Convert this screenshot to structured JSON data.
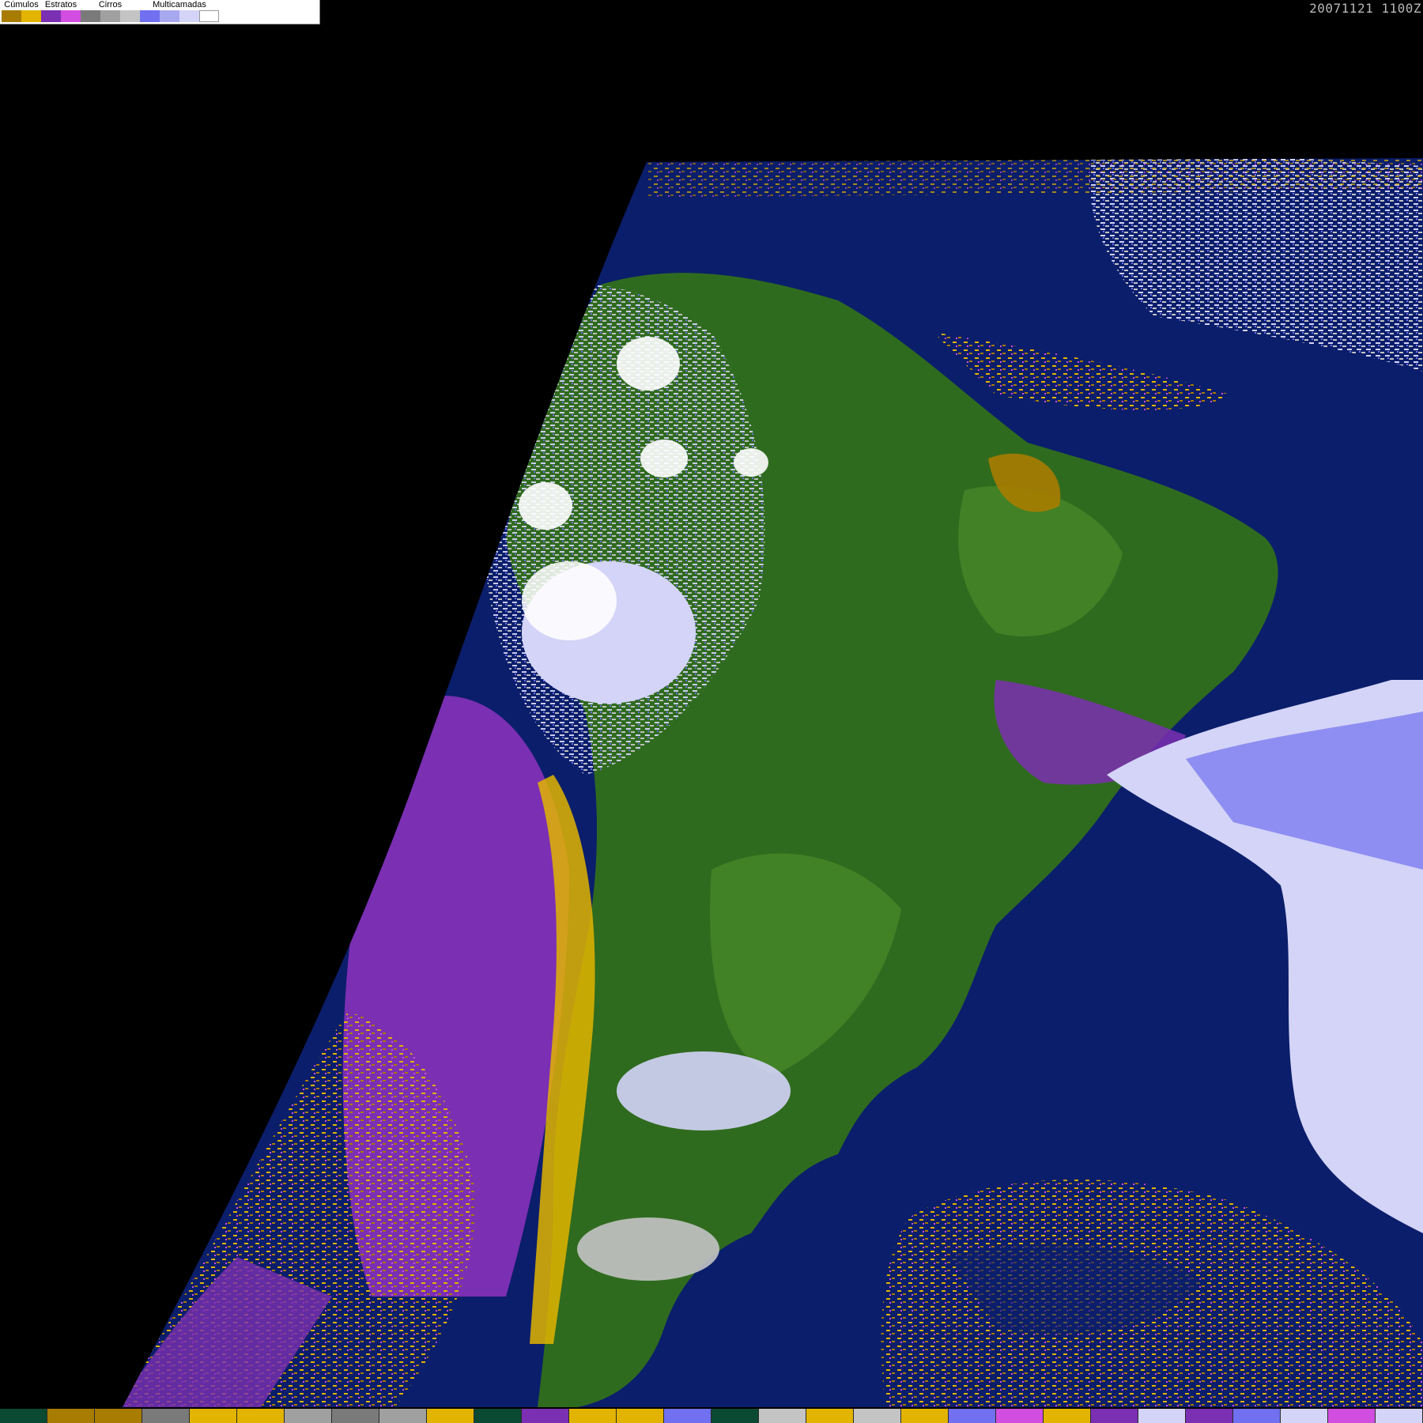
{
  "legend": {
    "groups": [
      {
        "label": "Cúmulos",
        "colors": [
          "#a87c00",
          "#e2b400"
        ]
      },
      {
        "label": "Estratos",
        "colors": [
          "#7b2fb2",
          "#d24ee0"
        ]
      },
      {
        "label": "Cirros",
        "colors": [
          "#7a7a7a",
          "#a0a0a0",
          "#c4c4c4"
        ]
      },
      {
        "label": "Multicamadas",
        "colors": [
          "#7070f0",
          "#a8a8f0",
          "#d4d4f8",
          "#ffffff"
        ]
      }
    ]
  },
  "timestamp": "20071121 1100Z",
  "map": {
    "colors": {
      "background": "#000000",
      "ocean": "#0b1e6b",
      "land": "#2f6b1e",
      "land_light": "#4a8a2a",
      "stratus": "#7b2fb2",
      "stratus_light": "#d24ee0",
      "cumulus": "#e2b400",
      "cumulus_dark": "#a87c00",
      "cirrus": "#c4c4c4",
      "multilayer": "#7070f0",
      "multilayer_light": "#d4d4f8"
    }
  },
  "bottom_strip": {
    "colors": [
      "#0a4a32",
      "#a87c00",
      "#a87c00",
      "#7a7a7a",
      "#e2b400",
      "#e2b400",
      "#a0a0a0",
      "#7a7a7a",
      "#a0a0a0",
      "#e2b400",
      "#0a4a32",
      "#7b2fb2",
      "#e2b400",
      "#e2b400",
      "#7070f0",
      "#0a4a32",
      "#c4c4c4",
      "#e2b400",
      "#c4c4c4",
      "#e2b400",
      "#7070f0",
      "#d24ee0",
      "#e2b400",
      "#7b2fb2",
      "#d4d4f8",
      "#7b2fb2",
      "#7070f0",
      "#d4d4f8",
      "#d24ee0",
      "#d4d4f8"
    ]
  }
}
